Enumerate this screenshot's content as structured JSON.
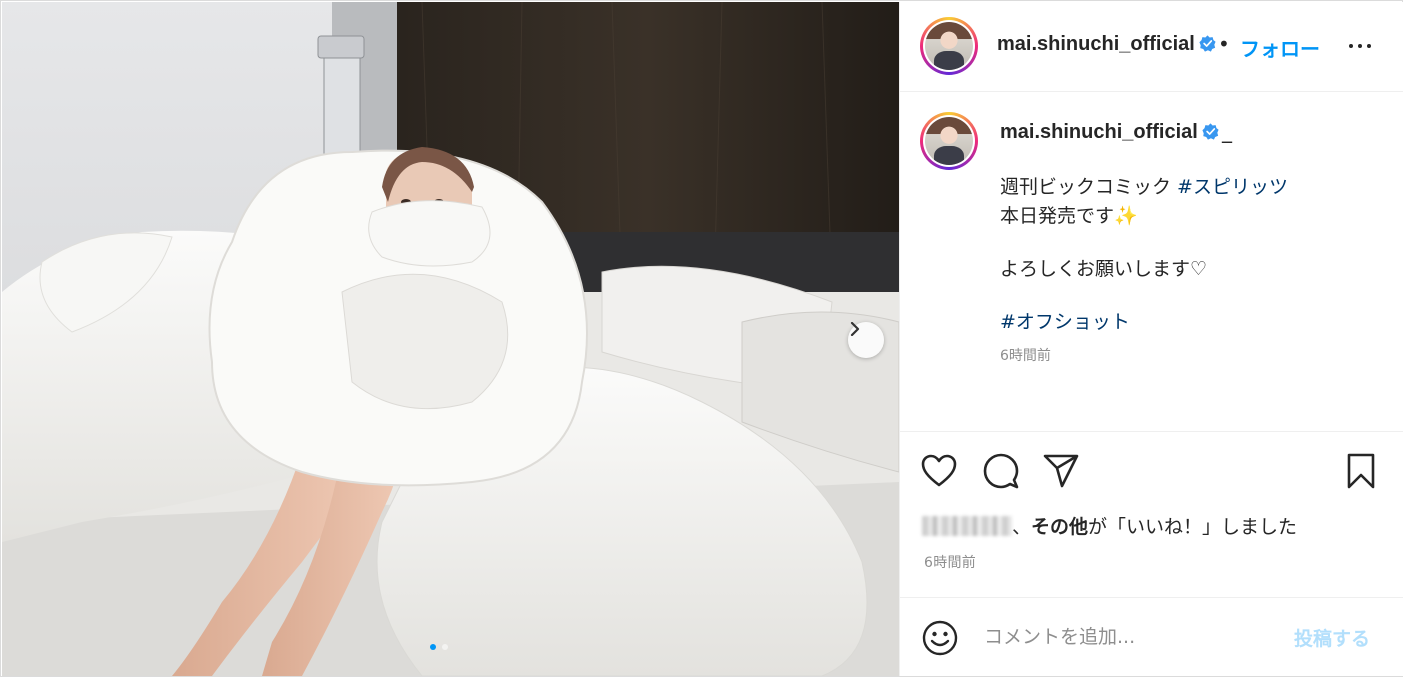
{
  "post": {
    "username": "mai.shinuchi_official",
    "follow_label": "フォロー",
    "separator": "•",
    "caption_marker": "_",
    "caption_lines": [
      {
        "text": "週刊ビックコミック ",
        "tag": "#スピリッツ"
      },
      {
        "text": "本日発売です✨"
      },
      {
        "text": "よろしくお願いします♡"
      },
      {
        "tag": "#オフショット"
      }
    ],
    "caption_time": "6時間前",
    "likes_suffix": "、",
    "likes_bold": "その他",
    "likes_rest": "が「いいね！」しました",
    "post_time": "6時間前",
    "comment_placeholder": "コメントを追加...",
    "post_button": "投稿する",
    "carousel": {
      "total": 2,
      "current": 1
    }
  },
  "colors": {
    "link_blue": "#0095f6",
    "hashtag": "#00376b",
    "muted": "#8e8e8e",
    "post_button_disabled": "#b2dffc",
    "verified": "#3897f0"
  },
  "icons": [
    "photo-image",
    "chevron-right-icon",
    "verified-badge-icon",
    "more-options-icon",
    "heart-icon",
    "comment-icon",
    "share-icon",
    "bookmark-icon",
    "emoji-icon"
  ]
}
